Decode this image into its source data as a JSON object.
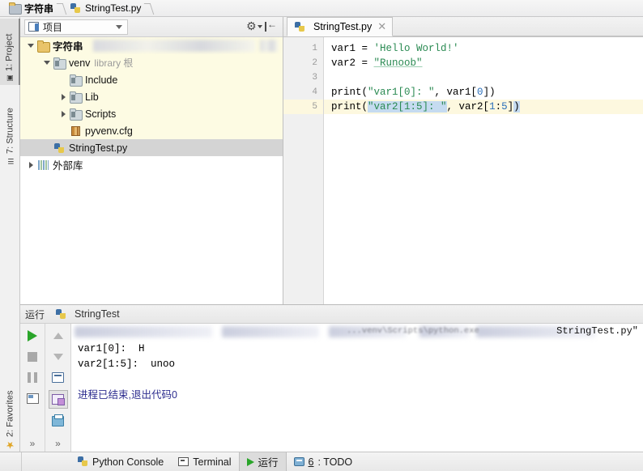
{
  "breadcrumb": {
    "items": [
      {
        "label": "字符串",
        "icon": "folder-icon",
        "bold": true
      },
      {
        "label": "StringTest.py",
        "icon": "python-file-icon",
        "bold": false
      }
    ]
  },
  "left_strip": {
    "tabs": [
      {
        "label": "1: Project",
        "icon": "project-icon",
        "selected": true
      },
      {
        "label": "7: Structure",
        "icon": "structure-icon",
        "selected": false
      },
      {
        "label": "2: Favorites",
        "icon": "star-icon",
        "selected": false
      }
    ]
  },
  "project_panel": {
    "header": {
      "title": "项目",
      "title_icon": "project-icon",
      "dropdown_icon": "chevron-down-icon",
      "settings_icon": "gear-icon",
      "collapse_icon": "collapse-all-icon"
    },
    "tree": [
      {
        "label": "字符串",
        "sub": "",
        "icon": "folder-icon",
        "depth": 0,
        "twisty": "down",
        "bold": true,
        "highlight": "yellow",
        "redacted": true
      },
      {
        "label": "venv",
        "sub": "library 根",
        "icon": "library-folder-icon",
        "depth": 1,
        "twisty": "down",
        "bold": false,
        "highlight": "yellow",
        "redacted": false
      },
      {
        "label": "Include",
        "sub": "",
        "icon": "library-folder-icon",
        "depth": 2,
        "twisty": "none",
        "bold": false,
        "highlight": "yellow",
        "redacted": false
      },
      {
        "label": "Lib",
        "sub": "",
        "icon": "library-folder-icon",
        "depth": 2,
        "twisty": "right",
        "bold": false,
        "highlight": "yellow",
        "redacted": false
      },
      {
        "label": "Scripts",
        "sub": "",
        "icon": "library-folder-icon",
        "depth": 2,
        "twisty": "right",
        "bold": false,
        "highlight": "yellow",
        "redacted": false
      },
      {
        "label": "pyvenv.cfg",
        "sub": "",
        "icon": "config-file-icon",
        "depth": 2,
        "twisty": "none",
        "bold": false,
        "highlight": "yellow",
        "redacted": false
      },
      {
        "label": "StringTest.py",
        "sub": "",
        "icon": "python-file-icon",
        "depth": 1,
        "twisty": "none",
        "bold": false,
        "highlight": "selected",
        "redacted": false
      },
      {
        "label": "外部库",
        "sub": "",
        "icon": "external-libraries-icon",
        "depth": 0,
        "twisty": "right",
        "bold": false,
        "highlight": "none",
        "redacted": false
      }
    ]
  },
  "editor": {
    "tab": {
      "label": "StringTest.py",
      "icon": "python-file-icon",
      "close_icon": "close-icon"
    },
    "current_line": 5,
    "lines": [
      {
        "number": "1",
        "tokens": [
          {
            "t": "var1 ",
            "c": "var"
          },
          {
            "t": "= ",
            "c": "op"
          },
          {
            "t": "'Hello World!'",
            "c": "str"
          }
        ]
      },
      {
        "number": "2",
        "tokens": [
          {
            "t": "var2 ",
            "c": "var"
          },
          {
            "t": "= ",
            "c": "op"
          },
          {
            "t": "\"Runoob\"",
            "c": "str-u"
          }
        ]
      },
      {
        "number": "3",
        "tokens": []
      },
      {
        "number": "4",
        "tokens": [
          {
            "t": "print(",
            "c": "var"
          },
          {
            "t": "\"var1[0]: \"",
            "c": "str"
          },
          {
            "t": ", var1[",
            "c": "var"
          },
          {
            "t": "0",
            "c": "num"
          },
          {
            "t": "])",
            "c": "var"
          }
        ]
      },
      {
        "number": "5",
        "tokens": [
          {
            "t": "print(",
            "c": "var"
          },
          {
            "t": "\"var2[1:5]: \"",
            "c": "str",
            "sel": true
          },
          {
            "t": ", var2[",
            "c": "var"
          },
          {
            "t": "1",
            "c": "num"
          },
          {
            "t": ":",
            "c": "var"
          },
          {
            "t": "5",
            "c": "num"
          },
          {
            "t": "]",
            "c": "var"
          },
          {
            "t": ")",
            "c": "var",
            "sel": true
          }
        ]
      }
    ]
  },
  "run_panel": {
    "header_title": "运行",
    "tab_label": "StringTest",
    "tab_icon": "python-file-icon",
    "toolbar_left": [
      {
        "name": "run-button",
        "icon": "play-icon"
      },
      {
        "name": "stop-button",
        "icon": "stop-icon"
      },
      {
        "name": "pause-button",
        "icon": "pause-icon"
      },
      {
        "name": "console-button",
        "icon": "console-icon"
      },
      {
        "name": "expand-more-left",
        "icon": "chevron-double-right-icon"
      }
    ],
    "toolbar_right": [
      {
        "name": "scroll-up-button",
        "icon": "arrow-up-icon"
      },
      {
        "name": "scroll-down-button",
        "icon": "arrow-down-icon"
      },
      {
        "name": "soft-wrap-button",
        "icon": "soft-wrap-icon"
      },
      {
        "name": "restore-layout-button",
        "icon": "restore-layout-icon"
      },
      {
        "name": "print-button",
        "icon": "print-icon"
      },
      {
        "name": "expand-more-right",
        "icon": "chevron-double-right-icon"
      }
    ],
    "console": {
      "command_line_tail": "StringTest.py\"",
      "command_line_mid": "...venv\\Scripts\\python.exe",
      "output": [
        "var1[0]:  H",
        "var2[1:5]:  unoo",
        "",
        "进程已结束,退出代码0"
      ]
    }
  },
  "status_bar": {
    "items": [
      {
        "label": "Python Console",
        "icon": "python-icon",
        "active": false,
        "mnemonic": ""
      },
      {
        "label": "Terminal",
        "icon": "terminal-icon",
        "active": false,
        "mnemonic": ""
      },
      {
        "label": "运行",
        "icon": "play-icon",
        "active": true,
        "mnemonic": ""
      },
      {
        "label": ": TODO",
        "icon": "todo-icon",
        "active": false,
        "mnemonic": "6"
      }
    ]
  },
  "colors": {
    "accent_green": "#2aa52a",
    "string_green": "#2a8a52",
    "number_blue": "#2a6fbb",
    "selection_blue": "#c5dbf0",
    "highlight_yellow": "#fdfbe3",
    "current_line": "#fdf8df",
    "console_zh": "#2d2d8f"
  }
}
